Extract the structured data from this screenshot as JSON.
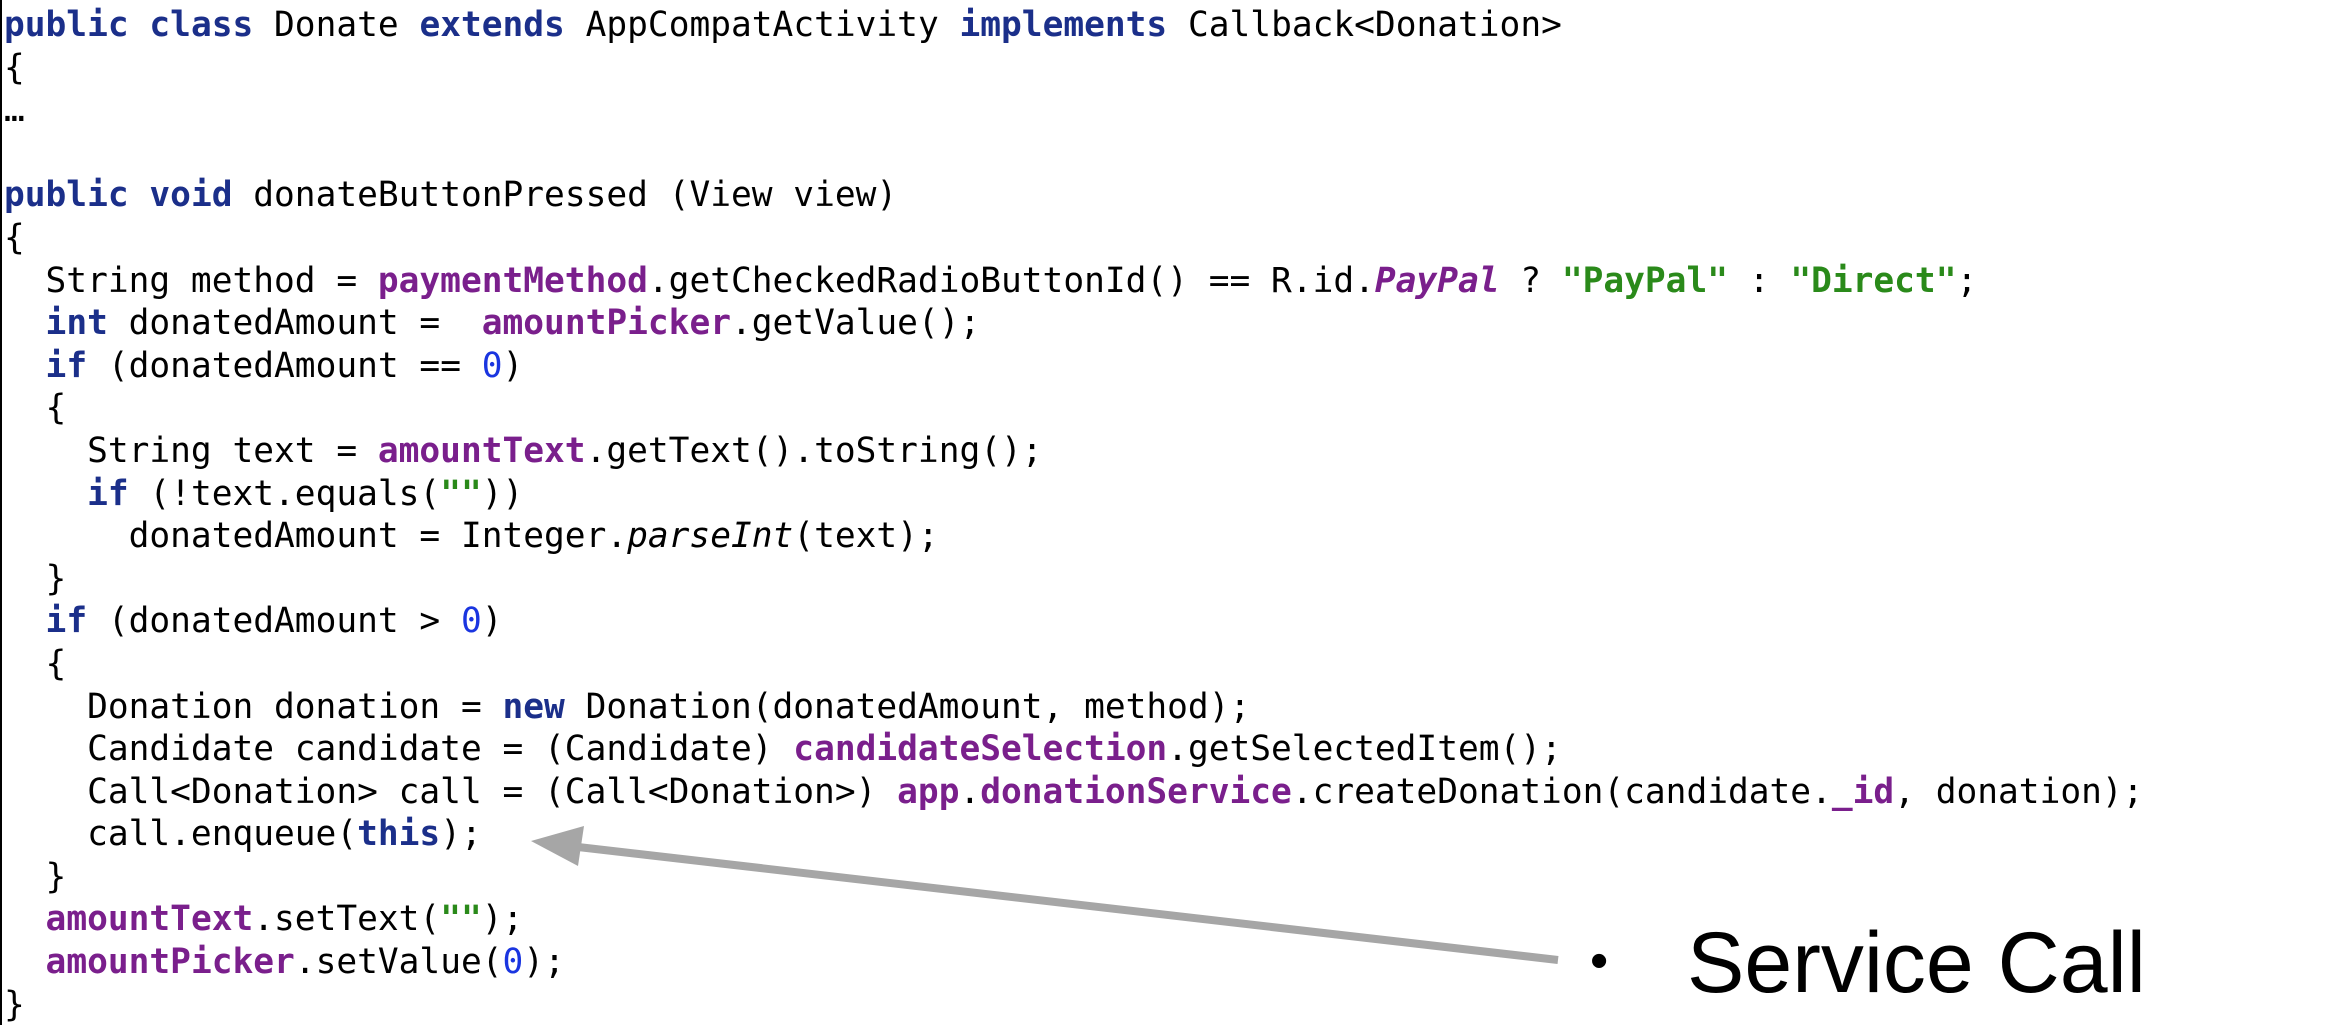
{
  "code": {
    "lines": [
      [
        {
          "t": "public",
          "c": "kw"
        },
        {
          "t": " "
        },
        {
          "t": "class",
          "c": "kw"
        },
        {
          "t": " Donate "
        },
        {
          "t": "extends",
          "c": "kw"
        },
        {
          "t": " AppCompatActivity "
        },
        {
          "t": "implements",
          "c": "kw"
        },
        {
          "t": " Callback<Donation>"
        }
      ],
      [
        {
          "t": "{"
        }
      ],
      [
        {
          "t": "…"
        }
      ],
      [],
      [
        {
          "t": "public",
          "c": "kw"
        },
        {
          "t": " "
        },
        {
          "t": "void",
          "c": "kw"
        },
        {
          "t": " donateButtonPressed (View view)"
        }
      ],
      [
        {
          "t": "{"
        }
      ],
      [
        {
          "t": "  String method = "
        },
        {
          "t": "paymentMethod",
          "c": "field"
        },
        {
          "t": ".getCheckedRadioButtonId() == R.id."
        },
        {
          "t": "PayPal",
          "c": "italic-field"
        },
        {
          "t": " ? "
        },
        {
          "t": "\"PayPal\"",
          "c": "str"
        },
        {
          "t": " : "
        },
        {
          "t": "\"Direct\"",
          "c": "str"
        },
        {
          "t": ";"
        }
      ],
      [
        {
          "t": "  "
        },
        {
          "t": "int",
          "c": "kw"
        },
        {
          "t": " donatedAmount =  "
        },
        {
          "t": "amountPicker",
          "c": "field"
        },
        {
          "t": ".getValue();"
        }
      ],
      [
        {
          "t": "  "
        },
        {
          "t": "if",
          "c": "kw"
        },
        {
          "t": " (donatedAmount == "
        },
        {
          "t": "0",
          "c": "num"
        },
        {
          "t": ")"
        }
      ],
      [
        {
          "t": "  {"
        }
      ],
      [
        {
          "t": "    String text = "
        },
        {
          "t": "amountText",
          "c": "field"
        },
        {
          "t": ".getText().toString();"
        }
      ],
      [
        {
          "t": "    "
        },
        {
          "t": "if",
          "c": "kw"
        },
        {
          "t": " (!text.equals("
        },
        {
          "t": "\"\"",
          "c": "str"
        },
        {
          "t": "))"
        }
      ],
      [
        {
          "t": "      donatedAmount = Integer."
        },
        {
          "t": "parseInt",
          "c": "italic"
        },
        {
          "t": "(text);"
        }
      ],
      [
        {
          "t": "  }"
        }
      ],
      [
        {
          "t": "  "
        },
        {
          "t": "if",
          "c": "kw"
        },
        {
          "t": " (donatedAmount > "
        },
        {
          "t": "0",
          "c": "num"
        },
        {
          "t": ")"
        }
      ],
      [
        {
          "t": "  {"
        }
      ],
      [
        {
          "t": "    Donation donation = "
        },
        {
          "t": "new",
          "c": "kw"
        },
        {
          "t": " Donation(donatedAmount, method);"
        }
      ],
      [
        {
          "t": "    Candidate candidate = (Candidate) "
        },
        {
          "t": "candidateSelection",
          "c": "field"
        },
        {
          "t": ".getSelectedItem();"
        }
      ],
      [
        {
          "t": "    Call<Donation> call = (Call<Donation>) "
        },
        {
          "t": "app",
          "c": "field"
        },
        {
          "t": "."
        },
        {
          "t": "donationService",
          "c": "field"
        },
        {
          "t": ".createDonation(candidate."
        },
        {
          "t": "_id",
          "c": "field"
        },
        {
          "t": ", donation);"
        }
      ],
      [
        {
          "t": "    call.enqueue("
        },
        {
          "t": "this",
          "c": "kw"
        },
        {
          "t": ");"
        }
      ],
      [
        {
          "t": "  }"
        }
      ],
      [
        {
          "t": "  "
        },
        {
          "t": "amountText",
          "c": "field"
        },
        {
          "t": ".setText("
        },
        {
          "t": "\"\"",
          "c": "str"
        },
        {
          "t": ");"
        }
      ],
      [
        {
          "t": "  "
        },
        {
          "t": "amountPicker",
          "c": "field"
        },
        {
          "t": ".setValue("
        },
        {
          "t": "0",
          "c": "num"
        },
        {
          "t": ");"
        }
      ],
      [
        {
          "t": "}"
        }
      ]
    ]
  },
  "callout": {
    "bullet": "•",
    "label": "Service Call"
  },
  "colors": {
    "keyword": "#1b2f8a",
    "field": "#7a1f8c",
    "string": "#2a8a1a",
    "number": "#1a35e0",
    "arrow": "#a6a6a6"
  }
}
